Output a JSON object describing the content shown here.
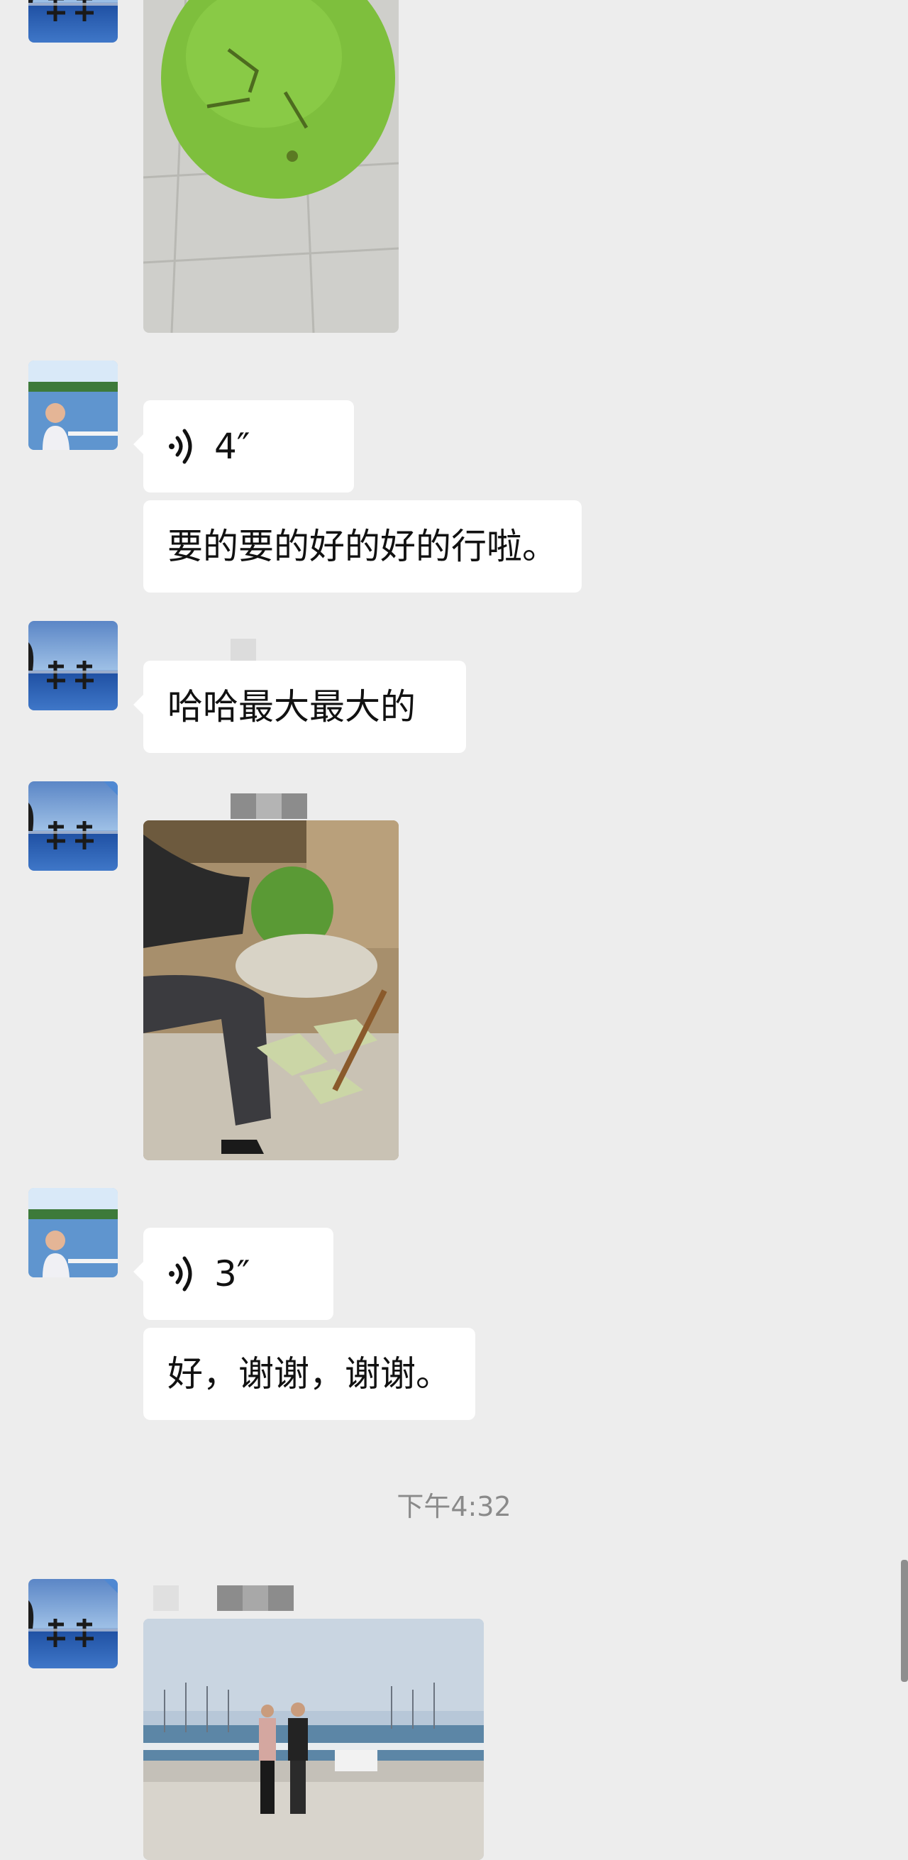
{
  "messages": {
    "voice1": {
      "duration": "4″"
    },
    "text1": {
      "text": "要的要的好的好的行啦。"
    },
    "text2": {
      "text": "哈哈最大最大的"
    },
    "voice2": {
      "duration": "3″"
    },
    "text3": {
      "text": "好，谢谢，谢谢。"
    }
  },
  "timestamp": "下午4:32",
  "colors": {
    "background": "#ededed",
    "bubble": "#ffffff",
    "timestamp": "#8a8a8a"
  },
  "icons": {
    "voice": "voice-wave-icon"
  }
}
